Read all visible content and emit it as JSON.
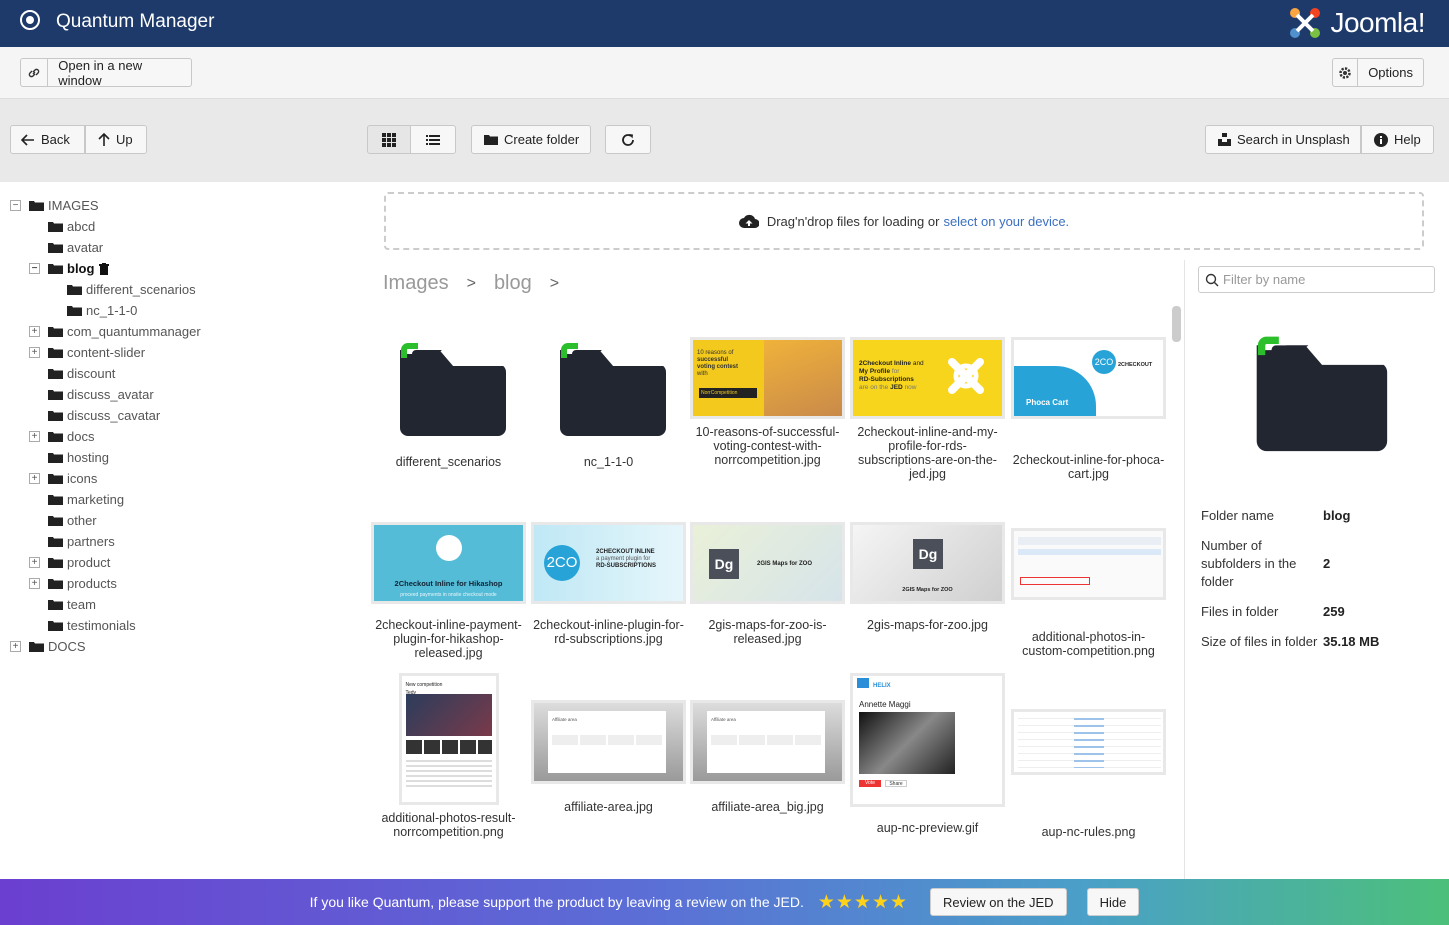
{
  "header": {
    "title": "Quantum Manager",
    "brand": "Joomla!"
  },
  "toolbar": {
    "open_new_window": "Open in a new window",
    "options": "Options"
  },
  "nav": {
    "back": "Back",
    "up": "Up",
    "create_folder": "Create folder",
    "search_unsplash": "Search in Unsplash",
    "help": "Help"
  },
  "tree": {
    "images_root": "IMAGES",
    "items": [
      "abcd",
      "avatar",
      "blog",
      "different_scenarios",
      "nc_1-1-0",
      "com_quantummanager",
      "content-slider",
      "discount",
      "discuss_avatar",
      "discuss_cavatar",
      "docs",
      "hosting",
      "icons",
      "marketing",
      "other",
      "partners",
      "product",
      "products",
      "team",
      "testimonials"
    ],
    "docs_root": "DOCS"
  },
  "dropzone": {
    "text": "Drag'n'drop files for loading or",
    "link": "select on your device."
  },
  "breadcrumb": [
    "Images",
    "blog"
  ],
  "files": [
    "different_scenarios",
    "nc_1-1-0",
    "10-reasons-of-successful-voting-contest-with-norrcompetition.jpg",
    "2checkout-inline-and-my-profile-for-rds-subscriptions-are-on-the-jed.jpg",
    "2checkout-inline-for-phoca-cart.jpg",
    "2checkout-inline-payment-plugin-for-hikashop-released.jpg",
    "2checkout-inline-plugin-for-rd-subscriptions.jpg",
    "2gis-maps-for-zoo-is-released.jpg",
    "2gis-maps-for-zoo.jpg",
    "additional-photos-in-custom-competition.png",
    "additional-photos-result-norrcompetition.png",
    "affiliate-area.jpg",
    "affiliate-area_big.jpg",
    "aup-nc-preview.gif",
    "aup-nc-rules.png"
  ],
  "thumb_text": {
    "t1_line1": "10 reasons of",
    "t1_line2": "successful",
    "t1_line3": "voting contest",
    "t1_line4": "with",
    "t1_badge": "NorrCompetition",
    "t2_line1": "2Checkout Inline",
    "t2_line1b": "and",
    "t2_line2": "My Profile",
    "t2_line2b": "for",
    "t2_line3": "RD-Subscriptions",
    "t2_line4": "are on the",
    "t2_line4b": "JED",
    "t2_line4c": "now",
    "t3_logo": "2CO",
    "t3_brand": "2CHECKOUT",
    "t3_product": "Phoca Cart",
    "t4_title": "2Checkout Inline for Hikashop",
    "t4_sub": "proceed payments in onsite checkout mode",
    "t5_logo": "2CO",
    "t5_line1": "2CHECKOUT INLINE",
    "t5_line2": "a payment plugin for",
    "t5_line3": "RD-SUBSCRIPTIONS",
    "t6_logo": "Dg",
    "t6_title": "2GIS Maps for ZOO",
    "t7_logo": "Dg",
    "t7_title": "2GIS Maps for ZOO",
    "t8_heading": "New competition",
    "t8_sub": "Tedy",
    "t9_title": "Affiliate area",
    "t10_title": "Affiliate area",
    "t11_brand": "HELIX",
    "t11_name": "Annette Maggi",
    "t11_vote": "Vote",
    "t11_share": "Share"
  },
  "info": {
    "filter_placeholder": "Filter by name",
    "rows": [
      {
        "k": "Folder name",
        "v": "blog"
      },
      {
        "k": "Number of subfolders in the folder",
        "v": "2"
      },
      {
        "k": "Files in folder",
        "v": "259"
      },
      {
        "k": "Size of files in folder",
        "v": "35.18 MB"
      }
    ]
  },
  "banner": {
    "text": "If you like Quantum, please support the product by leaving a review on the JED.",
    "stars": "★★★★★",
    "review": "Review on the JED",
    "hide": "Hide"
  },
  "colors": {
    "header": "#1d3a6b",
    "accent_green": "#2bc02b",
    "link": "#3b6fc1"
  }
}
